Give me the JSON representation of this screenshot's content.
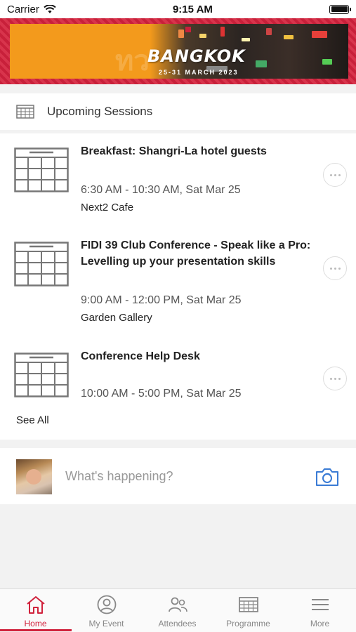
{
  "status_bar": {
    "carrier": "Carrier",
    "time": "9:15 AM"
  },
  "banner": {
    "title": "BANGKOK",
    "dates": "25-31 MARCH 2023",
    "colors": {
      "frame": "#c8203a",
      "background": "#f39a1c"
    }
  },
  "sessions": {
    "header": "Upcoming Sessions",
    "items": [
      {
        "title": "Breakfast: Shangri-La hotel guests",
        "time": "6:30 AM - 10:30 AM, Sat Mar 25",
        "venue": "Next2 Cafe"
      },
      {
        "title": "FIDI 39 Club Conference - Speak like a Pro: Levelling up your presentation skills",
        "time": "9:00 AM - 12:00 PM, Sat Mar 25",
        "venue": "Garden Gallery"
      },
      {
        "title": "Conference Help Desk",
        "time": "10:00 AM - 5:00 PM, Sat Mar 25",
        "venue": ""
      }
    ],
    "see_all": "See All"
  },
  "post": {
    "placeholder": "What's happening?"
  },
  "tab_bar": {
    "accent": "#d0223c",
    "tabs": [
      {
        "label": "Home",
        "icon": "home-icon",
        "active": true
      },
      {
        "label": "My Event",
        "icon": "user-circle-icon",
        "active": false
      },
      {
        "label": "Attendees",
        "icon": "people-icon",
        "active": false
      },
      {
        "label": "Programme",
        "icon": "calendar-icon",
        "active": false
      },
      {
        "label": "More",
        "icon": "menu-icon",
        "active": false
      }
    ]
  }
}
